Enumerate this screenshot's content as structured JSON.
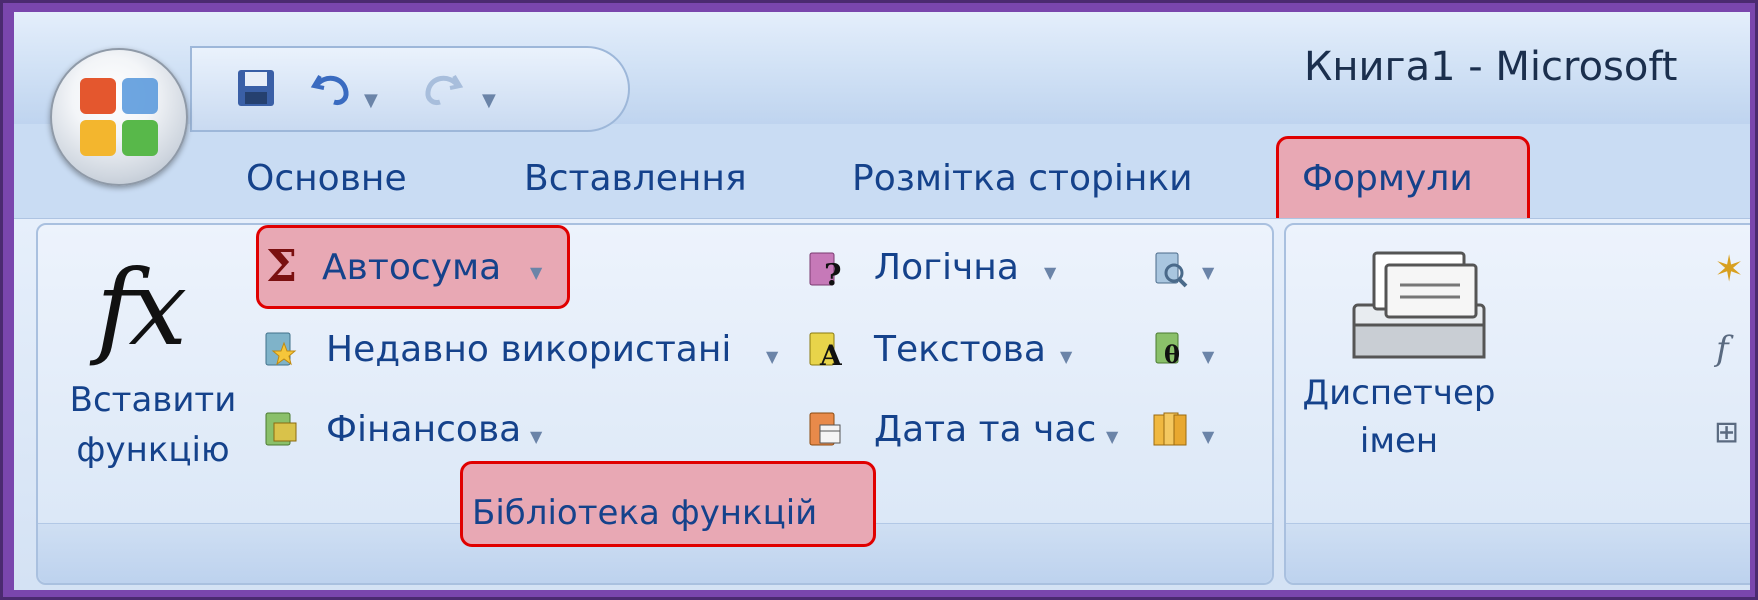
{
  "window": {
    "title": "Книга1 - Microsoft"
  },
  "tabs": [
    {
      "label": "Основне"
    },
    {
      "label": "Вставлення"
    },
    {
      "label": "Розмітка сторінки"
    },
    {
      "label": "Формули",
      "selected": true
    }
  ],
  "function_library": {
    "group_label": "Бібліотека функцій",
    "insert_function": {
      "line1": "Вставити",
      "line2": "функцію",
      "icon": "fx-icon"
    },
    "items": [
      {
        "label": "Автосума",
        "icon": "sigma-icon"
      },
      {
        "label": "Недавно використані",
        "icon": "star-book-icon"
      },
      {
        "label": "Фінансова",
        "icon": "money-book-icon"
      },
      {
        "label": "Логічна",
        "icon": "question-book-icon"
      },
      {
        "label": "Текстова",
        "icon": "text-book-icon"
      },
      {
        "label": "Дата та час",
        "icon": "calendar-book-icon"
      }
    ]
  },
  "defined_names": {
    "name_manager": {
      "line1": "Диспетчер",
      "line2": "імен",
      "icon": "card-file-icon"
    }
  },
  "colors": {
    "highlight_border": "#e00000",
    "highlight_fill": "#e8a8b4",
    "ribbon_text": "#15428b",
    "frame": "#7a46ad"
  }
}
